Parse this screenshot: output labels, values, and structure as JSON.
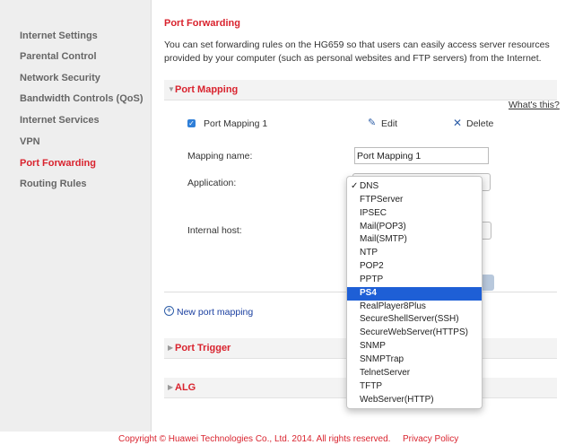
{
  "sidebar": {
    "items": [
      {
        "label": "Internet Settings"
      },
      {
        "label": "Parental Control"
      },
      {
        "label": "Network Security"
      },
      {
        "label": "Bandwidth Controls (QoS)"
      },
      {
        "label": "Internet Services"
      },
      {
        "label": "VPN"
      },
      {
        "label": "Port Forwarding",
        "active": true
      },
      {
        "label": "Routing Rules"
      }
    ]
  },
  "main": {
    "title": "Port Forwarding",
    "description": "You can set forwarding rules on the HG659 so that users can easily access server resources provided by your computer (such as personal websites and FTP servers) from the Internet.",
    "port_mapping": {
      "section_label": "Port Mapping",
      "whats_this": "What's this?",
      "entry": {
        "label": "Port Mapping 1",
        "checked": true
      },
      "edit_label": "Edit",
      "delete_label": "Delete",
      "mapping_name_label": "Mapping name:",
      "mapping_name_value": "Port Mapping 1",
      "application_label": "Application:",
      "internal_host_label": "Internal host:",
      "add_link": "New port mapping"
    },
    "port_trigger_label": "Port Trigger",
    "alg_label": "ALG"
  },
  "application_dropdown": {
    "checked_option": "DNS",
    "highlighted_option": "PS4",
    "options": [
      "DNS",
      "FTPServer",
      "IPSEC",
      "Mail(POP3)",
      "Mail(SMTP)",
      "NTP",
      "POP2",
      "PPTP",
      "PS4",
      "RealPlayer8Plus",
      "SecureShellServer(SSH)",
      "SecureWebServer(HTTPS)",
      "SNMP",
      "SNMPTrap",
      "TelnetServer",
      "TFTP",
      "WebServer(HTTP)"
    ]
  },
  "footer": {
    "copyright": "Copyright © Huawei Technologies Co., Ltd. 2014. All rights reserved.",
    "privacy": "Privacy Policy"
  },
  "colors": {
    "accent": "#d9232e",
    "link": "#1a3fa0",
    "selection": "#1e5fd6"
  },
  "icons": {
    "edit": "pencil-icon",
    "delete": "close-icon",
    "add": "plus-circle-icon",
    "check": "checkmark-icon"
  }
}
